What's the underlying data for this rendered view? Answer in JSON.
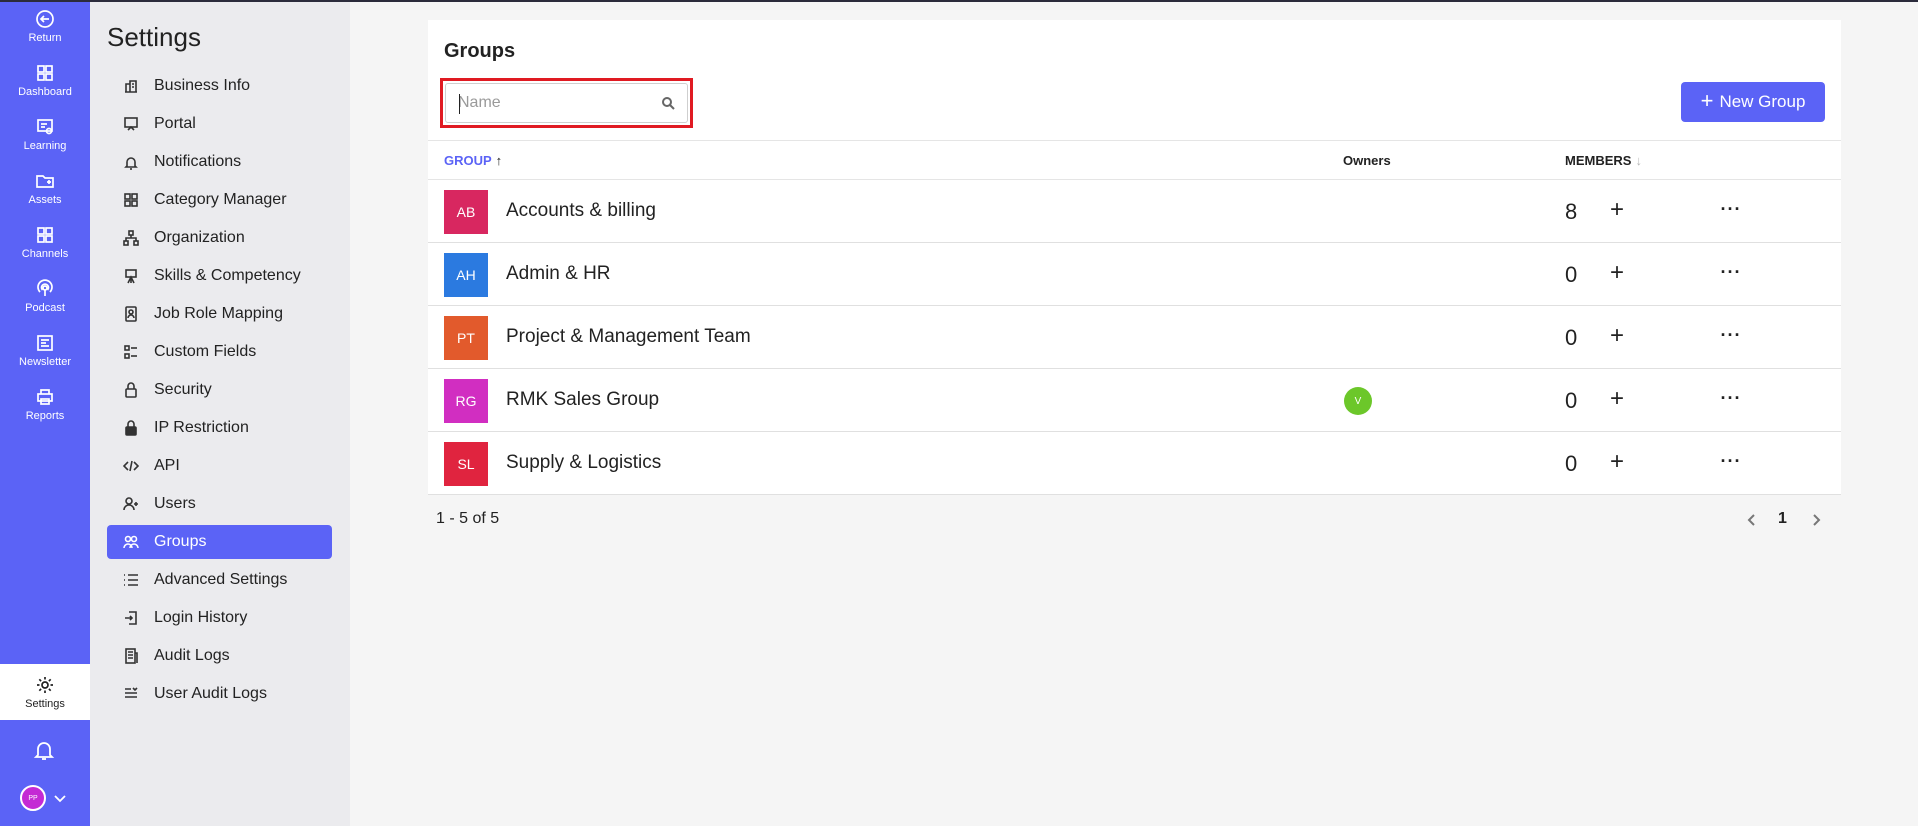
{
  "rail": {
    "items": [
      {
        "label": "Return",
        "icon": "return-icon"
      },
      {
        "label": "Dashboard",
        "icon": "dashboard-icon"
      },
      {
        "label": "Learning",
        "icon": "learning-icon"
      },
      {
        "label": "Assets",
        "icon": "assets-icon"
      },
      {
        "label": "Channels",
        "icon": "channels-icon"
      },
      {
        "label": "Podcast",
        "icon": "podcast-icon"
      },
      {
        "label": "Newsletter",
        "icon": "newsletter-icon"
      },
      {
        "label": "Reports",
        "icon": "reports-icon"
      }
    ],
    "settings_label": "Settings",
    "avatar_initials": "PP",
    "accent": "#5b63f6"
  },
  "settings": {
    "title": "Settings",
    "items": [
      {
        "label": "Business Info",
        "icon": "building-icon"
      },
      {
        "label": "Portal",
        "icon": "portal-icon"
      },
      {
        "label": "Notifications",
        "icon": "bell-icon"
      },
      {
        "label": "Category Manager",
        "icon": "grid-icon"
      },
      {
        "label": "Organization",
        "icon": "org-chart-icon"
      },
      {
        "label": "Skills & Competency",
        "icon": "skills-icon"
      },
      {
        "label": "Job Role Mapping",
        "icon": "id-badge-icon"
      },
      {
        "label": "Custom Fields",
        "icon": "fields-icon"
      },
      {
        "label": "Security",
        "icon": "lock-open-icon"
      },
      {
        "label": "IP Restriction",
        "icon": "lock-icon"
      },
      {
        "label": "API",
        "icon": "code-icon"
      },
      {
        "label": "Users",
        "icon": "user-add-icon"
      },
      {
        "label": "Groups",
        "icon": "users-icon"
      },
      {
        "label": "Advanced Settings",
        "icon": "list-icon"
      },
      {
        "label": "Login History",
        "icon": "login-icon"
      },
      {
        "label": "Audit Logs",
        "icon": "audit-icon"
      },
      {
        "label": "User Audit Logs",
        "icon": "user-audit-icon"
      }
    ],
    "active_index": 12
  },
  "main": {
    "title": "Groups",
    "search": {
      "placeholder": "Name",
      "value": ""
    },
    "new_group_label": "New Group",
    "columns": {
      "group": "GROUP",
      "owners": "Owners",
      "members": "MEMBERS"
    },
    "rows": [
      {
        "initials": "AB",
        "name": "Accounts & billing",
        "color": "#d82760",
        "owner": "",
        "members": "8"
      },
      {
        "initials": "AH",
        "name": "Admin & HR",
        "color": "#2b7ae0",
        "owner": "",
        "members": "0"
      },
      {
        "initials": "PT",
        "name": "Project & Management Team",
        "color": "#e25a2c",
        "owner": "",
        "members": "0"
      },
      {
        "initials": "RG",
        "name": "RMK Sales Group",
        "color": "#d12ec1",
        "owner": "V",
        "owner_color": "#6cc72a",
        "members": "0"
      },
      {
        "initials": "SL",
        "name": "Supply & Logistics",
        "color": "#e0243f",
        "owner": "",
        "members": "0"
      }
    ],
    "range_text": "1 - 5 of 5",
    "page": "1"
  }
}
